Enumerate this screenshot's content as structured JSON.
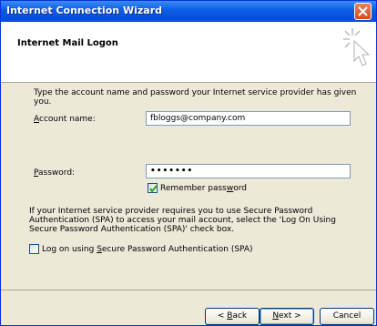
{
  "window": {
    "title": "Internet Connection Wizard"
  },
  "header": {
    "title": "Internet Mail Logon"
  },
  "content": {
    "intro": "Type the account name and password your Internet service provider has given you.",
    "account": {
      "label_accel": "A",
      "label_rest": "ccount name:",
      "value": "fbloggs@company.com"
    },
    "password": {
      "label_accel": "P",
      "label_rest": "assword:",
      "value": "•••••••"
    },
    "remember": {
      "label_pre": "Remember pass",
      "label_accel": "w",
      "label_post": "ord",
      "checked": true
    },
    "spa_paragraph": "If your Internet service provider requires you to use Secure Password Authentication (SPA) to access your mail account, select the 'Log On Using Secure Password Authentication (SPA)' check box.",
    "spa_checkbox": {
      "label_pre": "Log on using ",
      "label_accel": "S",
      "label_post": "ecure Password Authentication (SPA)",
      "checked": false
    }
  },
  "buttons": {
    "back": {
      "pre": "< ",
      "accel": "B",
      "post": "ack"
    },
    "next": {
      "accel": "N",
      "post": "ext >"
    },
    "cancel": "Cancel"
  },
  "colors": {
    "titlebar": "#0a5de6",
    "dialog_bg": "#ece9d8",
    "close": "#d8491c"
  }
}
